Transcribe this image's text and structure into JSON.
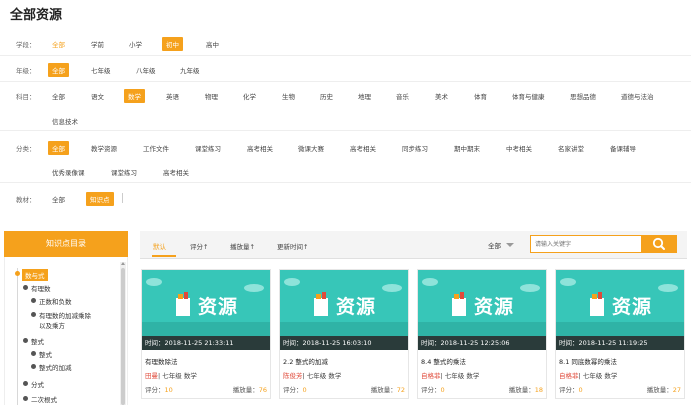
{
  "page_title": "全部资源",
  "filters": {
    "stage": {
      "label": "学段：",
      "options": [
        "全部",
        "学前",
        "小学",
        "初中",
        "高中"
      ],
      "selected": "初中"
    },
    "grade": {
      "label": "年级：",
      "options": [
        "全部",
        "七年级",
        "八年级",
        "九年级"
      ],
      "selected": "全部"
    },
    "subject": {
      "label": "科目：",
      "options": [
        "全部",
        "语文",
        "数学",
        "英语",
        "物理",
        "化学",
        "生物",
        "历史",
        "地理",
        "音乐",
        "美术",
        "体育",
        "体育与健康",
        "思想品德",
        "道德与法治",
        "信息技术"
      ],
      "selected": "数学"
    },
    "category": {
      "label": "分类：",
      "options": [
        "全部",
        "教学资源",
        "工作文件",
        "课堂练习",
        "高考相关",
        "微课大赛",
        "高考相关",
        "同步练习",
        "期中期末",
        "中考相关",
        "名家讲堂",
        "备课辅导",
        "优秀录像课",
        "课堂练习",
        "高考相关"
      ],
      "selected": "全部"
    },
    "material": {
      "label": "教材：",
      "options": [
        "全部",
        "知识点"
      ],
      "selected": "知识点"
    }
  },
  "sidebar": {
    "title": "知识点目录",
    "tree": [
      {
        "label": "数与式",
        "level": 0,
        "active": true
      },
      {
        "label": "有理数",
        "level": 1
      },
      {
        "label": "正数和负数",
        "level": 2
      },
      {
        "label": "有理数的加减乘除",
        "level": 2
      },
      {
        "label": "以及乘方",
        "level": 2,
        "cont": true
      },
      {
        "label": "整式",
        "level": 1
      },
      {
        "label": "整式",
        "level": 2
      },
      {
        "label": "整式的加减",
        "level": 2
      },
      {
        "label": "分式",
        "level": 1
      },
      {
        "label": "二次根式",
        "level": 1
      }
    ]
  },
  "toolbar": {
    "sorts": [
      "默认",
      "评分↑",
      "播放量↑",
      "更新时间↑"
    ],
    "active_sort": "默认",
    "scope": "全部",
    "search_placeholder": "请输入关键字"
  },
  "cards": [
    {
      "banner": "资源",
      "time": "时间：2018-11-25 21:33:11",
      "title": "有理数除法",
      "author": "田曼",
      "grade": "七年级",
      "subject": "数学",
      "score_label": "评分：",
      "score": "10",
      "plays_label": "播放量：",
      "plays": "76"
    },
    {
      "banner": "资源",
      "time": "时间：2018-11-25 16:03:10",
      "title": "2.2 整式的加减",
      "author": "陈俊芳",
      "grade": "七年级",
      "subject": "数学",
      "score_label": "评分：",
      "score": "0",
      "plays_label": "播放量：",
      "plays": "72"
    },
    {
      "banner": "资源",
      "time": "时间：2018-11-25 12:25:06",
      "title": "8.4 整式的乘法",
      "author": "自格菲",
      "grade": "七年级",
      "subject": "数学",
      "score_label": "评分：",
      "score": "0",
      "plays_label": "播放量：",
      "plays": "18"
    },
    {
      "banner": "资源",
      "time": "时间：2018-11-25 11:19:25",
      "title": "8.1 同底数幂的乘法",
      "author": "自格菲",
      "grade": "七年级",
      "subject": "数学",
      "score_label": "评分：",
      "score": "0",
      "plays_label": "播放量：",
      "plays": "27"
    }
  ],
  "colors": {
    "accent": "#f5a11c",
    "banner": "#37c6b8",
    "time_bar": "#2a3b3a",
    "author": "#e04a3a"
  },
  "icons": {
    "search": "search-icon",
    "caret": "chevron-down-icon"
  }
}
